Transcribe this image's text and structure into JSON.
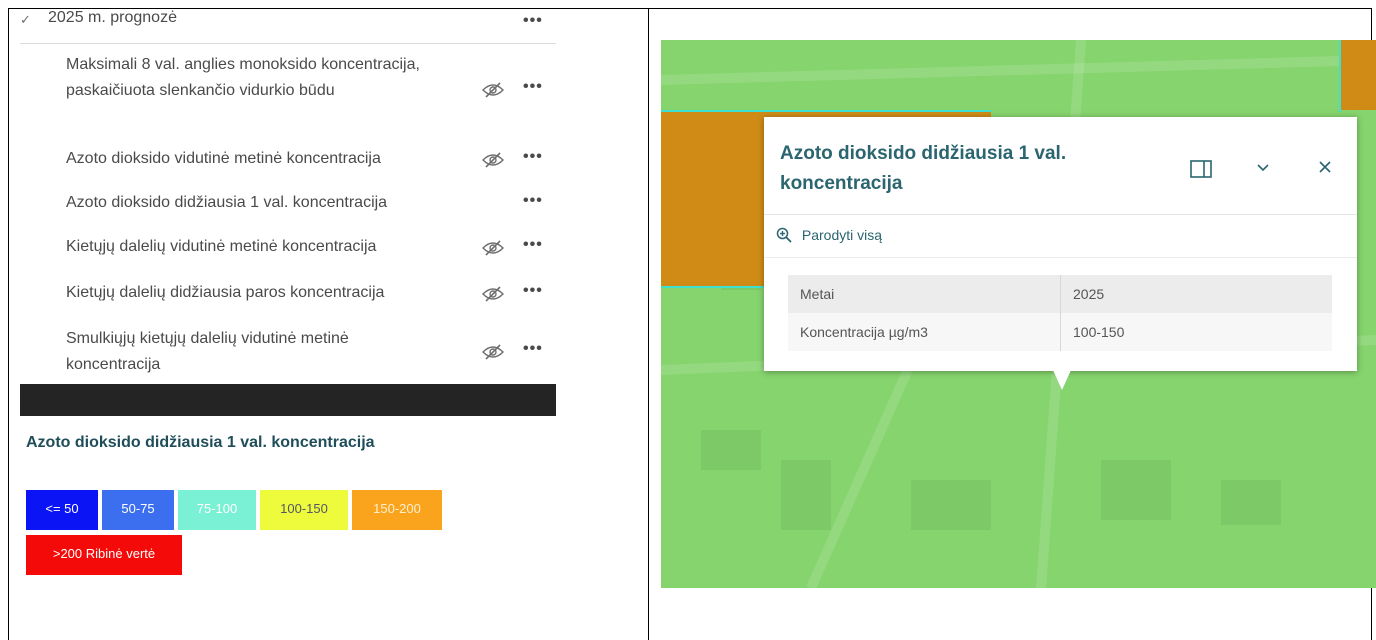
{
  "layer_list": {
    "group": {
      "title": "2025 m. prognozė",
      "chevron": "check-chevron-icon"
    },
    "layers": [
      {
        "label": "Maksimali 8 val. anglies monoksido koncentracija, paskaičiuota slenkančio vidurkio būdu",
        "hidden": true
      },
      {
        "label": "Azoto dioksido vidutinė metinė koncentracija",
        "hidden": true
      },
      {
        "label": "Azoto dioksido didžiausia 1 val. koncentracija",
        "hidden": false
      },
      {
        "label": "Kietųjų dalelių vidutinė metinė koncentracija",
        "hidden": true
      },
      {
        "label": "Kietųjų dalelių didžiausia paros koncentracija",
        "hidden": true
      },
      {
        "label": "Smulkiųjų kietųjų dalelių vidutinė metinė koncentracija",
        "hidden": true
      }
    ],
    "more_label": "•••"
  },
  "legend": {
    "title": "Azoto dioksido didžiausia 1 val. koncentracija",
    "classes": [
      {
        "label": "<= 50",
        "color": "#0a14f5"
      },
      {
        "label": "50-75",
        "color": "#3b6ff0"
      },
      {
        "label": "75-100",
        "color": "#7af0d4"
      },
      {
        "label": "100-150",
        "color": "#eefb3c"
      },
      {
        "label": "150-200",
        "color": "#f9a41c"
      },
      {
        "label": ">200 Ribinė vertė",
        "color": "#f50a0a"
      }
    ]
  },
  "popup": {
    "title": "Azoto dioksido didžiausia 1 val. koncentracija",
    "zoom_label": "Parodyti visą",
    "rows": [
      {
        "key": "Metai",
        "value": "2025"
      },
      {
        "key": "Koncentracija µg/m3",
        "value": "100-150"
      }
    ],
    "buttons": {
      "dock": "dock-icon",
      "collapse": "chevron-down-icon",
      "close": "close-icon"
    }
  },
  "colors": {
    "map_base": "#86d46e",
    "exceed_area": "#cf8b16",
    "boundary": "#3fe0d0",
    "accent": "#2a6570"
  }
}
